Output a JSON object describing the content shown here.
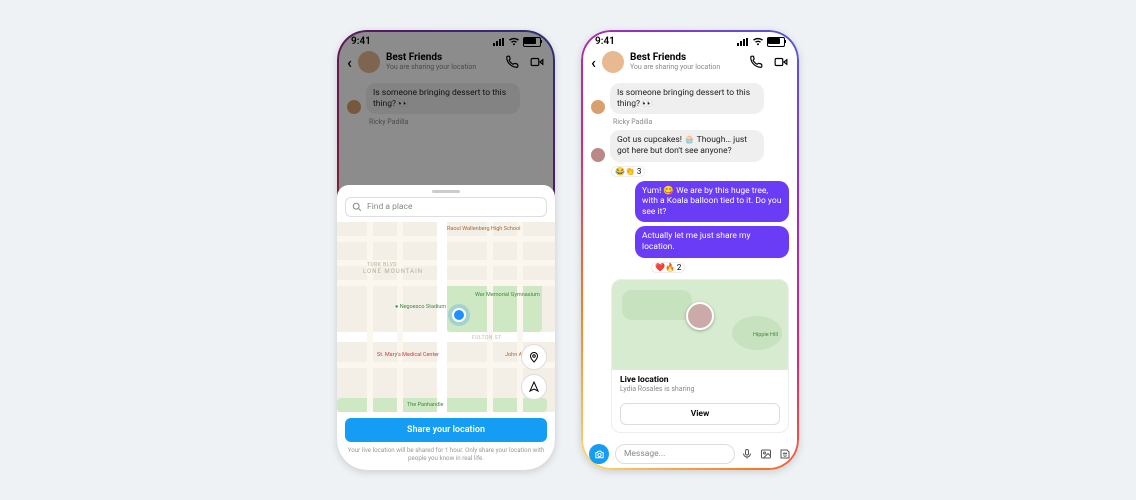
{
  "status_time": "9:41",
  "chat": {
    "title": "Best Friends",
    "subtitle": "You are sharing your location",
    "sender1": "Ricky Padilla",
    "msg1": "Is someone bringing dessert to this thing? 👀",
    "msg2": "Got us cupcakes! 🧁 Though… just got here but don't see anyone?",
    "react2": "😂👏 3",
    "msg3": "Yum! 😋 We are by this huge tree, with a Koala balloon tied to it. Do you see it?",
    "msg4": "Actually let me just share my location.",
    "react4": "❤️🔥 2"
  },
  "sheet": {
    "search_placeholder": "Find a place",
    "cta": "Share your location",
    "disclaimer": "Your live location will be shared for 1 hour. Only share your location with people you know in real life.",
    "area": "LONE MOUNTAIN",
    "poi_school": "Raoul Wallenberg\nHigh School",
    "poi_stadium": "Negoesco Stadium",
    "poi_gym": "War Memorial\nGymnasium",
    "poi_hospital": "St. Mary's\nMedical Center",
    "poi_adams": "John\nAdams",
    "poi_panhandle": "The Panhandle",
    "st_turk": "TURK BLVD",
    "st_fulton": "FULTON ST"
  },
  "card": {
    "title": "Live location",
    "subtitle": "Lydia Rosales is sharing",
    "view": "View",
    "hill": "Hippie Hill"
  },
  "composer": {
    "placeholder": "Message..."
  }
}
